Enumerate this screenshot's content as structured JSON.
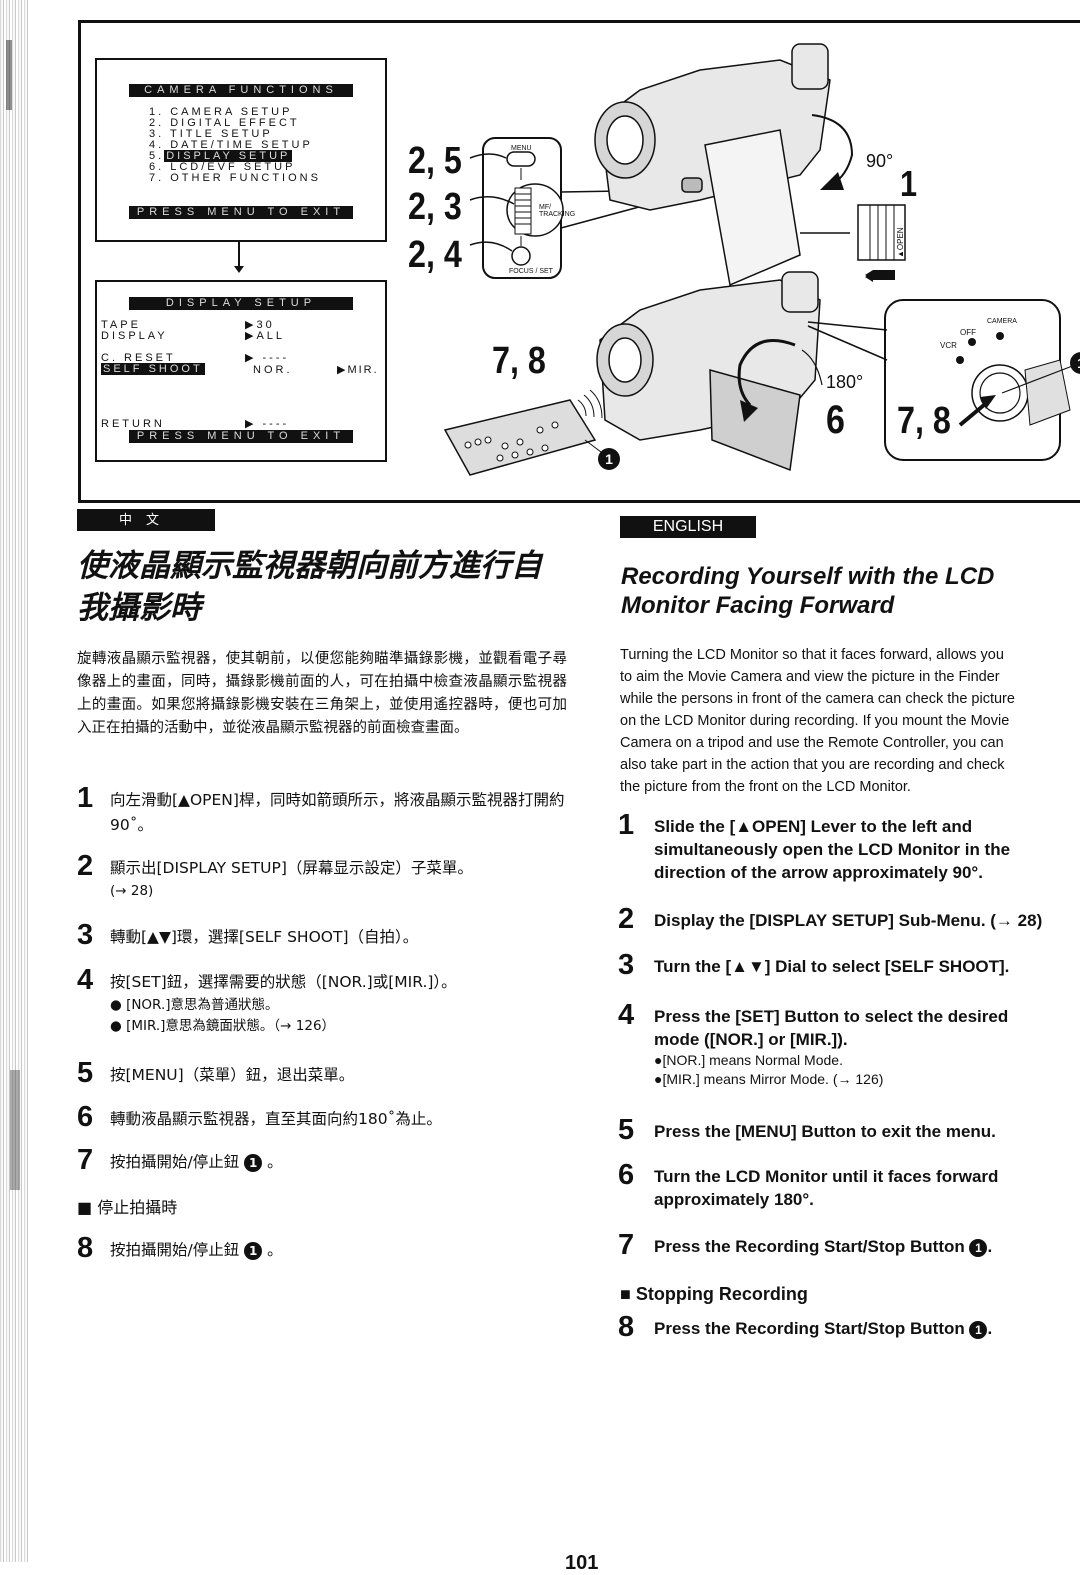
{
  "figure": {
    "camera_functions_screen": {
      "title": "CAMERA FUNCTIONS",
      "items": [
        "1. CAMERA SETUP",
        "2. DIGITAL EFFECT",
        "3. TITLE SETUP",
        "4. DATE/TIME SETUP",
        "5. DISPLAY SETUP",
        "6. LCD/EVF SETUP",
        "7. OTHER FUNCTIONS"
      ],
      "highlighted_item_prefix": "5.",
      "highlighted_item_label": "DISPLAY SETUP",
      "footer": "PRESS MENU TO EXIT"
    },
    "display_setup_screen": {
      "title": "DISPLAY SETUP",
      "rows": [
        {
          "label": "TAPE",
          "value": "▶30"
        },
        {
          "label": "DISPLAY",
          "value": "▶ALL"
        },
        {
          "label": "C. RESET",
          "value": "▶ ----"
        },
        {
          "label": "SELF SHOOT",
          "value": "NOR.",
          "value2": "▶MIR."
        },
        {
          "label": "RETURN",
          "value": "▶ ----"
        }
      ],
      "footer": "PRESS MENU TO EXIT"
    },
    "step_labels": {
      "menu_button": "2, 5",
      "dial": "2, 3",
      "set_button": "2, 4",
      "open_lever": "1",
      "rotate_lcd": "6",
      "remote": "7, 8",
      "start_stop": "7, 8"
    },
    "control_labels": {
      "menu": "MENU",
      "dial": "MF/ TRACKING",
      "focus_set": "FOCUS / SET",
      "open": "▲OPEN",
      "camera": "CAMERA",
      "off": "OFF",
      "vcr": "VCR"
    },
    "angles": {
      "open": "90°",
      "rotate": "180°"
    },
    "button_marker": "1"
  },
  "chinese": {
    "badge": "中文",
    "title": "使液晶顯示監視器朝向前方進行自我攝影時",
    "intro": "旋轉液晶顯示監視器，使其朝前，以便您能夠瞄準攝錄影機，並觀看電子尋像器上的畫面，同時，攝錄影機前面的人，可在拍攝中檢查液晶顯示監視器上的畫面。如果您將攝錄影機安裝在三角架上，並使用遙控器時，便也可加入正在拍攝的活動中，並從液晶顯示監視器的前面檢查畫面。",
    "steps": [
      {
        "num": "1",
        "text": "向左滑動[▲OPEN]桿，同時如箭頭所示，將液晶顯示監視器打開約90˚。"
      },
      {
        "num": "2",
        "text": "顯示出[DISPLAY SETUP]（屏幕显示設定）子菜單。",
        "ref": "(→ 28)"
      },
      {
        "num": "3",
        "text": "轉動[▲▼]環，選擇[SELF SHOOT]（自拍）。"
      },
      {
        "num": "4",
        "text": "按[SET]鈕，選擇需要的狀態（[NOR.]或[MIR.]）。",
        "bullets": [
          "● [NOR.]意思為普通狀態。",
          "● [MIR.]意思為鏡面狀態。（→ 126）"
        ]
      },
      {
        "num": "5",
        "text": "按[MENU]（菜單）鈕，退出菜單。"
      },
      {
        "num": "6",
        "text": "轉動液晶顯示監視器，直至其面向約180˚為止。"
      },
      {
        "num": "7",
        "text": "按拍攝開始/停止鈕",
        "suffix": "。"
      },
      {
        "num": "8",
        "text": "按拍攝開始/停止鈕",
        "suffix": "。"
      }
    ],
    "stop_heading": "■ 停止拍攝時"
  },
  "english": {
    "badge": "ENGLISH",
    "title_line1": "Recording Yourself with the LCD",
    "title_line2": "Monitor Facing Forward",
    "intro_lines": [
      "Turning the LCD Monitor so that it faces forward, allows you",
      "to aim the Movie Camera and view the picture in the Finder",
      "while the persons in front of the camera can check the picture",
      "on the LCD Monitor during recording. If you mount the Movie",
      "Camera on a tripod and use the Remote Controller, you can",
      "also take part in the action that you are recording and check",
      "the picture from the front on the LCD Monitor."
    ],
    "steps": [
      {
        "num": "1",
        "lines": [
          "Slide the [▲OPEN] Lever to the left and",
          "simultaneously open the LCD Monitor in the",
          "direction of the arrow approximately 90°."
        ]
      },
      {
        "num": "2",
        "lines": [
          "Display the [DISPLAY SETUP] Sub-Menu. (→ 28)"
        ]
      },
      {
        "num": "3",
        "lines": [
          "Turn the [▲▼] Dial to select [SELF SHOOT]."
        ]
      },
      {
        "num": "4",
        "lines": [
          "Press the [SET] Button to select the desired",
          "mode ([NOR.] or [MIR.])."
        ],
        "bullets": [
          "●[NOR.] means Normal Mode.",
          "●[MIR.] means Mirror Mode. (→ 126)"
        ]
      },
      {
        "num": "5",
        "lines": [
          "Press the [MENU] Button to exit the menu."
        ]
      },
      {
        "num": "6",
        "lines": [
          "Turn the LCD Monitor until it faces forward",
          "approximately 180°."
        ]
      },
      {
        "num": "7",
        "lines": [
          "Press the Recording Start/Stop Button"
        ],
        "suffix": "."
      },
      {
        "num": "8",
        "lines": [
          "Press the Recording Start/Stop Button"
        ],
        "suffix": "."
      }
    ],
    "stop_heading": "■  Stopping Recording"
  },
  "page_number": "101"
}
